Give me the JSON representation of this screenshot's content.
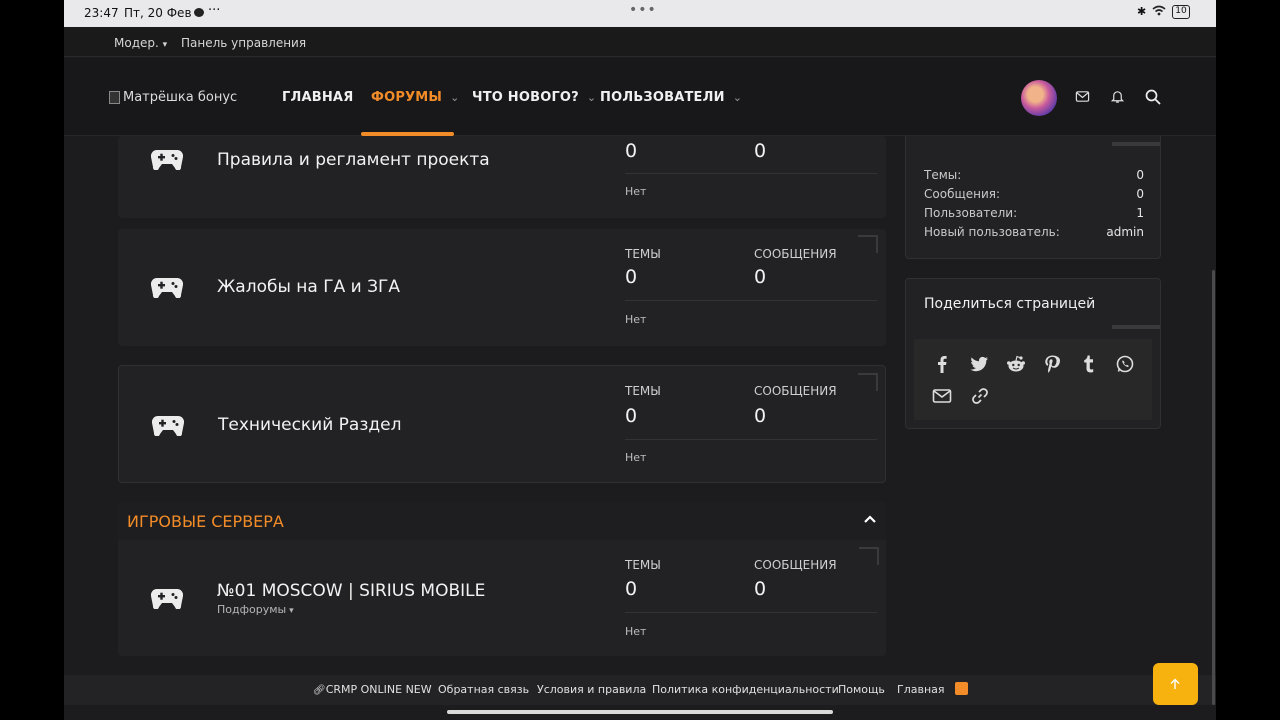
{
  "statusbar": {
    "time": "23:47",
    "date": "Пт, 20 Фев",
    "more": "···",
    "center": "•••",
    "battery": "10"
  },
  "topstrip": {
    "moderator": "Модер.",
    "panel": "Панель управления"
  },
  "nav": {
    "logo_alt": "Матрёшка бонус",
    "items": [
      "ГЛАВНАЯ",
      "ФОРУМЫ",
      "ЧТО НОВОГО?",
      "ПОЛЬЗОВАТЕЛИ"
    ],
    "active": "ФОРУМЫ",
    "accent": "#f28c28"
  },
  "forums": [
    {
      "title": "Правила и регламент проекта",
      "threads": "0",
      "messages": "0",
      "last": "Нет"
    },
    {
      "title": "Жалобы на ГА и ЗГА",
      "threads_label": "ТЕМЫ",
      "messages_label": "СООБЩЕНИЯ",
      "threads": "0",
      "messages": "0",
      "last": "Нет"
    },
    {
      "title": "Технический Раздел",
      "threads_label": "ТЕМЫ",
      "messages_label": "СООБЩЕНИЯ",
      "threads": "0",
      "messages": "0",
      "last": "Нет"
    }
  ],
  "category": {
    "title": "ИГРОВЫЕ СЕРВЕРА",
    "node": {
      "title": "№01 MOSCOW | SIRIUS MOBILE",
      "subforums": "Подфорумы",
      "threads_label": "ТЕМЫ",
      "messages_label": "СООБЩЕНИЯ",
      "threads": "0",
      "messages": "0",
      "last": "Нет"
    }
  },
  "stats": {
    "rows": [
      {
        "label": "Темы:",
        "value": "0"
      },
      {
        "label": "Сообщения:",
        "value": "0"
      },
      {
        "label": "Пользователи:",
        "value": "1"
      },
      {
        "label": "Новый пользователь:",
        "value": "admin"
      }
    ]
  },
  "share": {
    "title": "Поделиться страницей",
    "icons": [
      "facebook-icon",
      "twitter-icon",
      "reddit-icon",
      "pinterest-icon",
      "tumblr-icon",
      "whatsapp-icon",
      "email-icon",
      "link-icon"
    ]
  },
  "footer": {
    "links": [
      "CRMP ONLINE NEW",
      "Обратная связь",
      "Условия и правила",
      "Политика конфиденциальности",
      "Помощь",
      "Главная"
    ]
  }
}
